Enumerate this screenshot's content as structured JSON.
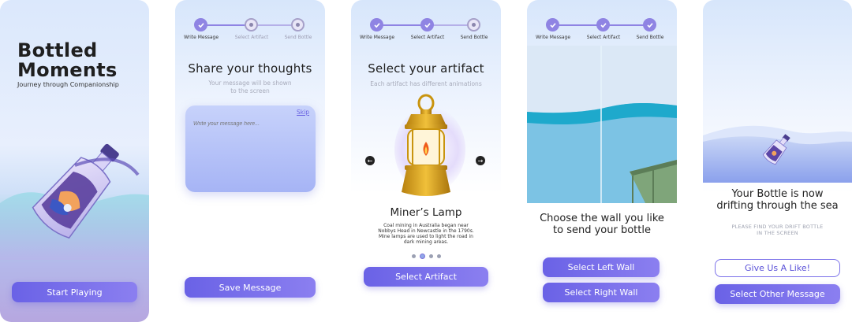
{
  "screen1": {
    "title": "Bottled Moments",
    "title_line1": "Bottled",
    "title_line2": "Moments",
    "tagline": "Journey through Companionship",
    "start_label": "Start Playing"
  },
  "stepper": {
    "steps": [
      "Write Message",
      "Select Artifact",
      "Send Bottle"
    ]
  },
  "screen2": {
    "heading": "Share your thoughts",
    "subtitle_line1": "Your message will be shown",
    "subtitle_line2": "to the screen",
    "skip_label": "Skip",
    "message_placeholder": "Write your message here...",
    "save_label": "Save Message",
    "step_state": [
      "done",
      "current",
      "todo"
    ]
  },
  "screen3": {
    "heading": "Select your artifact",
    "subtitle": "Each artifact has different animations",
    "artifact_name": "Miner’s Lamp",
    "artifact_desc_line1": "Coal mining in Australia began near",
    "artifact_desc_line2": "Nobbys Head in Newcastle in the 1790s.",
    "artifact_desc_line3": "Mine lamps are used to light the road in",
    "artifact_desc_line4": "dark mining areas.",
    "pager_count": 4,
    "pager_active": 1,
    "select_label": "Select Artifact",
    "prev_icon": "←",
    "next_icon": "→",
    "step_state": [
      "done",
      "done",
      "todo"
    ]
  },
  "screen4": {
    "caption_line1": "Choose the wall you like",
    "caption_line2": "to send your bottle",
    "left_wall_label": "Select Left Wall",
    "right_wall_label": "Select Right Wall",
    "step_state": [
      "done",
      "done",
      "done"
    ]
  },
  "screen5": {
    "heading_line1": "Your Bottle is now",
    "heading_line2": "drifting through the sea",
    "sub_line1": "PLEASE FIND YOUR DRIFT BOTTLE",
    "sub_line2": "IN THE SCREEN",
    "like_label": "Give Us A Like!",
    "other_label": "Select Other Message"
  },
  "colors": {
    "accent": "#7468e8",
    "accent_light": "#8f84e3",
    "sea": "#7fc5e6",
    "sea_dark": "#1eaecf"
  }
}
